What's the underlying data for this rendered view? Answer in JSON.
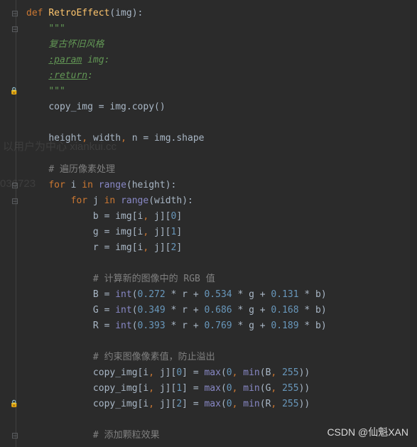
{
  "fn_def": {
    "kw": "def ",
    "name": "RetroEffect",
    "p1": "(",
    "arg": "img",
    "p2": "):"
  },
  "doc_open": "\"\"\"",
  "doc_desc": "复古怀旧风格",
  "doc_param_tag": ":param",
  "doc_param_rest": " img:",
  "doc_return_tag": ":return",
  "doc_return_rest": ":",
  "doc_close": "\"\"\"",
  "copy_line": {
    "a": "copy_img = img.copy",
    "p1": "(",
    "p2": ")"
  },
  "shape_line": {
    "a": "height",
    "c1": ", ",
    "b": "width",
    "c2": ", ",
    "c": "n = img.shape"
  },
  "cmt_iter": "# 遍历像素处理",
  "for_i": {
    "kw1": "for ",
    "v": "i ",
    "kw2": "in ",
    "fn": "range",
    "p1": "(",
    "a": "height",
    "p2": "):"
  },
  "for_j": {
    "kw1": "for ",
    "v": "j ",
    "kw2": "in ",
    "fn": "range",
    "p1": "(",
    "a": "width",
    "p2": "):"
  },
  "idx_b": {
    "a": "b = img[i",
    "c1": ", ",
    "b": "j][",
    "n": "0",
    "c2": "]"
  },
  "idx_g": {
    "a": "g = img[i",
    "c1": ", ",
    "b": "j][",
    "n": "1",
    "c2": "]"
  },
  "idx_r": {
    "a": "r = img[i",
    "c1": ", ",
    "b": "j][",
    "n": "2",
    "c2": "]"
  },
  "cmt_rgb": "# 计算新的图像中的 RGB 值",
  "calc_B": {
    "a": "B = ",
    "fn": "int",
    "p1": "(",
    "n1": "0.272",
    "t1": " * r + ",
    "n2": "0.534",
    "t2": " * g + ",
    "n3": "0.131",
    "t3": " * b)"
  },
  "calc_G": {
    "a": "G = ",
    "fn": "int",
    "p1": "(",
    "n1": "0.349",
    "t1": " * r + ",
    "n2": "0.686",
    "t2": " * g + ",
    "n3": "0.168",
    "t3": " * b)"
  },
  "calc_R": {
    "a": "R = ",
    "fn": "int",
    "p1": "(",
    "n1": "0.393",
    "t1": " * r + ",
    "n2": "0.769",
    "t2": " * g + ",
    "n3": "0.189",
    "t3": " * b)"
  },
  "cmt_clip": "# 约束图像像素值，防止溢出",
  "clip_B": {
    "a": "copy_img[i",
    "c1": ", ",
    "b": "j][",
    "n": "0",
    "c2": "] = ",
    "fn1": "max",
    "p1": "(",
    "z": "0",
    "c3": ", ",
    "fn2": "min",
    "p2": "(",
    "v": "B",
    "c4": ", ",
    "m": "255",
    "p3": "))"
  },
  "clip_G": {
    "a": "copy_img[i",
    "c1": ", ",
    "b": "j][",
    "n": "1",
    "c2": "] = ",
    "fn1": "max",
    "p1": "(",
    "z": "0",
    "c3": ", ",
    "fn2": "min",
    "p2": "(",
    "v": "G",
    "c4": ", ",
    "m": "255",
    "p3": "))"
  },
  "clip_R": {
    "a": "copy_img[i",
    "c1": ", ",
    "b": "j][",
    "n": "2",
    "c2": "] = ",
    "fn1": "max",
    "p1": "(",
    "z": "0",
    "c3": ", ",
    "fn2": "min",
    "p2": "(",
    "v": "R",
    "c4": ", ",
    "m": "255",
    "p3": "))"
  },
  "cmt_grain": "# 添加颗粒效果",
  "wm1": "以用户为中心",
  "wm1b": "xiankui.cc",
  "wm2": "036723",
  "attrib": "CSDN @仙魁XAN",
  "icons": {
    "fold_down": "⊟",
    "fold_right": "⊞",
    "lock": "🔒"
  }
}
